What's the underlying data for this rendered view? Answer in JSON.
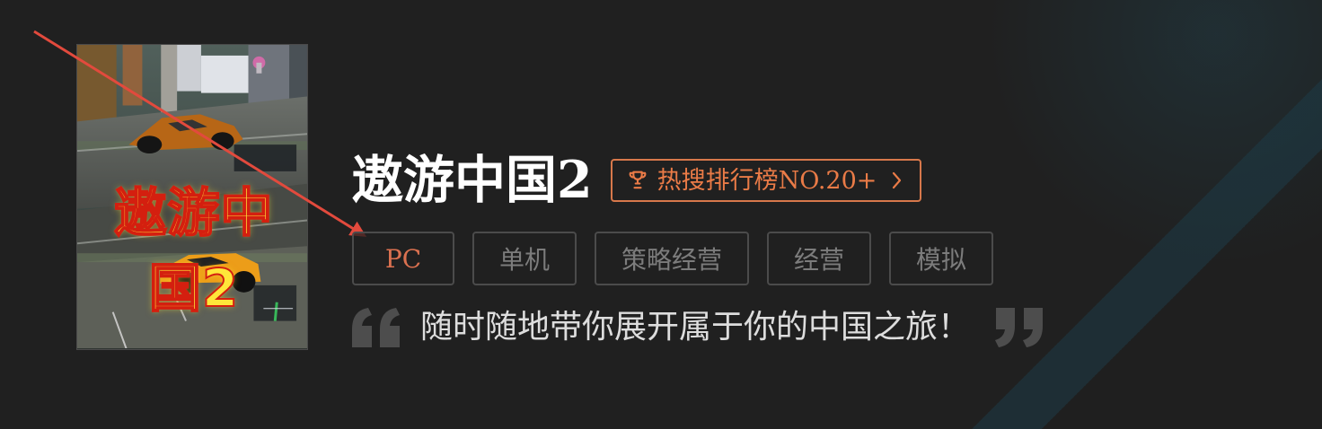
{
  "cover": {
    "title": "遨游中国2"
  },
  "game": {
    "title": "遨游中国2",
    "ranking": {
      "label": "热搜排行榜NO.20+",
      "icon": "trophy-icon"
    },
    "tags": [
      {
        "label": "PC",
        "active": true
      },
      {
        "label": "单机",
        "active": false
      },
      {
        "label": "策略经营",
        "active": false
      },
      {
        "label": "经营",
        "active": false
      },
      {
        "label": "模拟",
        "active": false
      }
    ],
    "slogan": "随时随地带你展开属于你的中国之旅！"
  },
  "colors": {
    "background": "#202020",
    "accent": "#ea7b47",
    "tag_border": "#4b4b4b",
    "tag_text": "#7c7c7c",
    "annotation": "#e24a3d"
  }
}
